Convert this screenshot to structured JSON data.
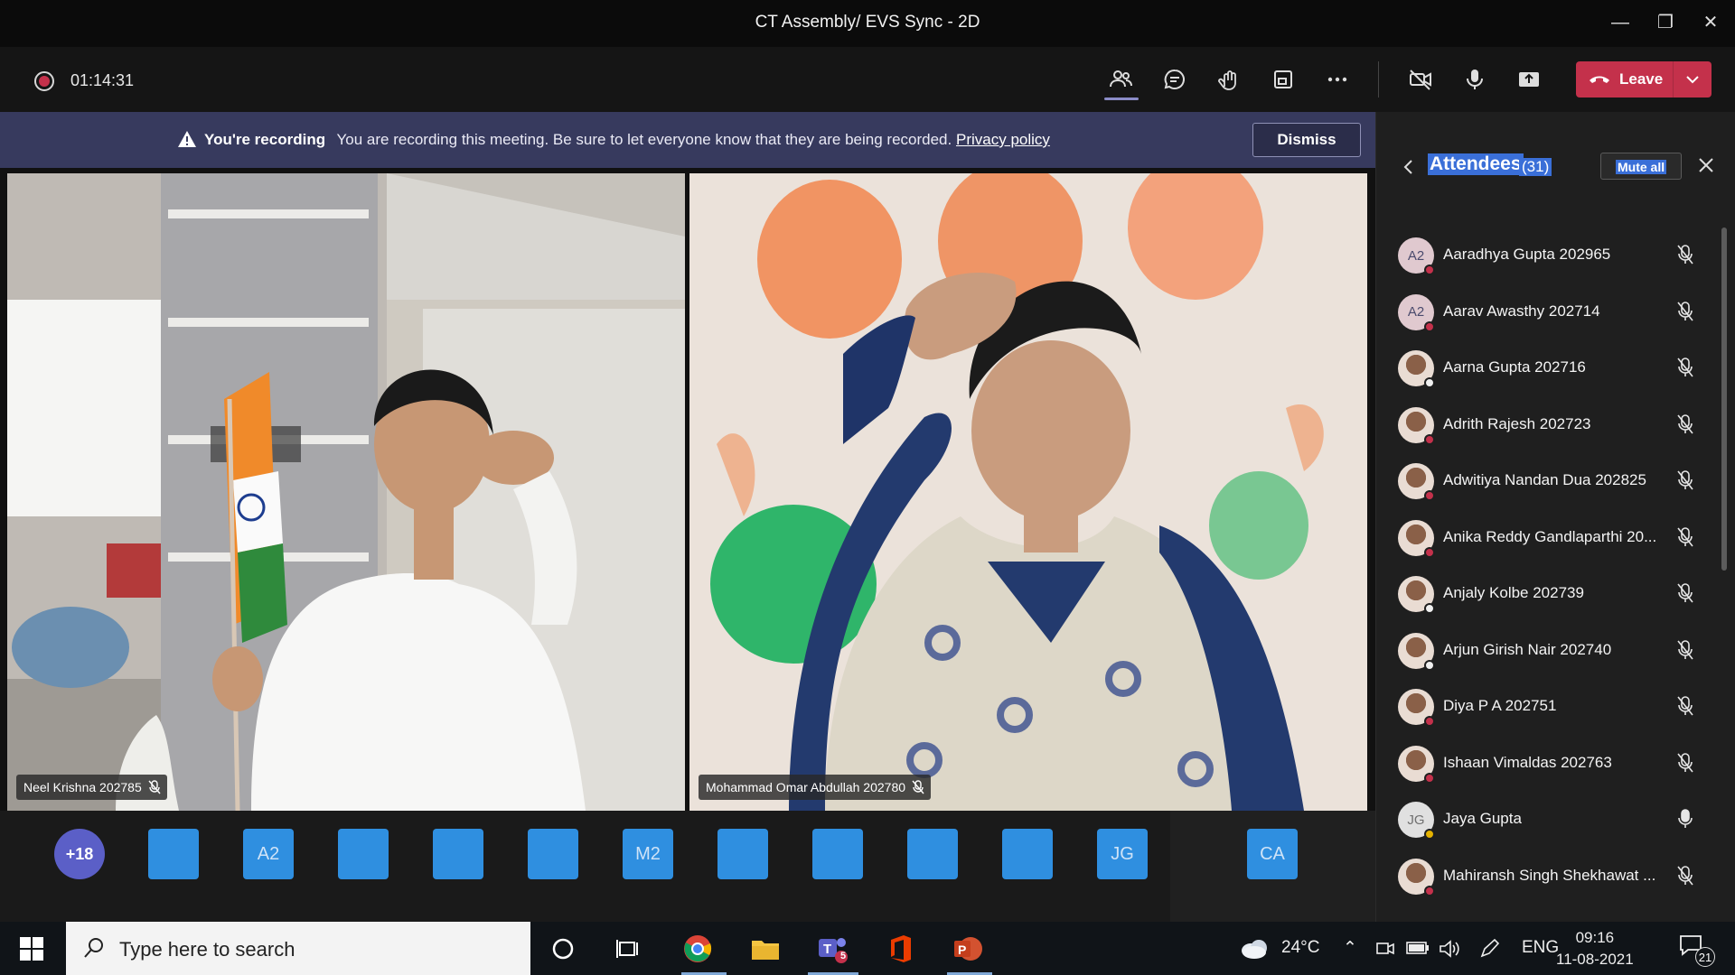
{
  "window": {
    "title": "CT Assembly/ EVS Sync - 2D"
  },
  "meeting": {
    "timer": "01:14:31",
    "leave_label": "Leave"
  },
  "banner": {
    "bold": "You're recording",
    "message": "You are recording this meeting. Be sure to let everyone know that they are being recorded.",
    "link": "Privacy policy",
    "dismiss": "Dismiss"
  },
  "videos": [
    {
      "name": "Neel Krishna 202785"
    },
    {
      "name": "Mohammad Omar Abdullah 202780"
    }
  ],
  "strip": {
    "more": "+18",
    "tiles": [
      "",
      "A2",
      "",
      "",
      "",
      "M2",
      "",
      "",
      "",
      "",
      "JG"
    ],
    "last": "CA"
  },
  "panel": {
    "title": "Attendees",
    "count": "(31)",
    "mute_all": "Mute all",
    "attendees": [
      {
        "initials": "A2",
        "name": "Aaradhya Gupta 202965",
        "photo": false,
        "status": "red",
        "muted": true
      },
      {
        "initials": "A2",
        "name": "Aarav Awasthy 202714",
        "photo": false,
        "status": "red",
        "muted": true
      },
      {
        "initials": "",
        "name": "Aarna Gupta 202716",
        "photo": true,
        "status": "white",
        "muted": true
      },
      {
        "initials": "",
        "name": "Adrith Rajesh 202723",
        "photo": true,
        "status": "red",
        "muted": true
      },
      {
        "initials": "",
        "name": "Adwitiya Nandan Dua 202825",
        "photo": true,
        "status": "red",
        "muted": true
      },
      {
        "initials": "",
        "name": "Anika Reddy Gandlaparthi 20...",
        "photo": true,
        "status": "red",
        "muted": true
      },
      {
        "initials": "",
        "name": "Anjaly Kolbe 202739",
        "photo": true,
        "status": "white",
        "muted": true
      },
      {
        "initials": "",
        "name": "Arjun Girish Nair 202740",
        "photo": true,
        "status": "white",
        "muted": true
      },
      {
        "initials": "",
        "name": "Diya P A 202751",
        "photo": true,
        "status": "red",
        "muted": true
      },
      {
        "initials": "",
        "name": "Ishaan Vimaldas 202763",
        "photo": true,
        "status": "red",
        "muted": true
      },
      {
        "initials": "JG",
        "name": "Jaya Gupta",
        "photo": false,
        "status": "yellow",
        "muted": false
      },
      {
        "initials": "",
        "name": "Mahiransh Singh Shekhawat ...",
        "photo": true,
        "status": "red",
        "muted": true
      }
    ]
  },
  "taskbar": {
    "search_placeholder": "Type here to search",
    "teams_badge": "5",
    "weather": "24°C",
    "language": "ENG",
    "time": "09:16",
    "date": "11-08-2021",
    "notifications": "21"
  }
}
